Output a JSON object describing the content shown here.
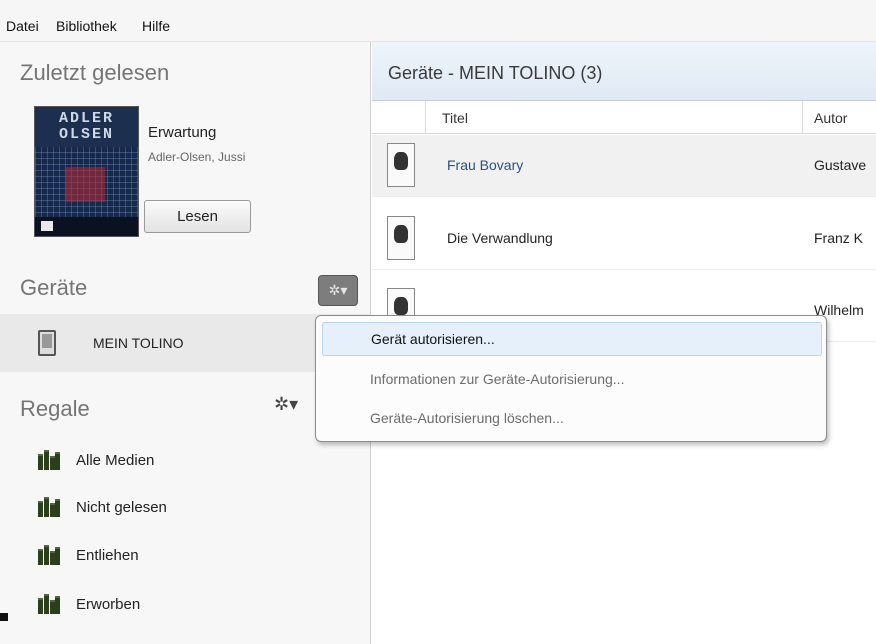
{
  "menubar": {
    "items": [
      "Datei",
      "Bibliothek",
      "Hilfe"
    ]
  },
  "sidebar": {
    "recent": {
      "heading": "Zuletzt gelesen",
      "book": {
        "cover_text": "ADLER OLSEN",
        "title": "Erwartung",
        "author": "Adler-Olsen, Jussi",
        "read_label": "Lesen"
      }
    },
    "devices": {
      "heading": "Geräte",
      "settings_icon": "gear-icon",
      "items": [
        {
          "label": "MEIN TOLINO",
          "icon": "ereader-icon"
        }
      ]
    },
    "shelves": {
      "heading": "Regale",
      "settings_icon": "gear-icon",
      "items": [
        {
          "label": "Alle Medien",
          "icon": "shelf-icon"
        },
        {
          "label": "Nicht gelesen",
          "icon": "shelf-icon"
        },
        {
          "label": "Entliehen",
          "icon": "shelf-icon"
        },
        {
          "label": "Erworben",
          "icon": "shelf-icon"
        }
      ]
    }
  },
  "main": {
    "header_title": "Geräte - MEIN TOLINO (3)",
    "columns": [
      "Titel",
      "Autor"
    ],
    "rows": [
      {
        "title": "Frau Bovary",
        "author": "Gustave",
        "selected": true,
        "title_color": "#2b4f86"
      },
      {
        "title": "Die Verwandlung",
        "author": "Franz K",
        "selected": false,
        "title_color": "#222222"
      },
      {
        "title": "",
        "author": "Wilhelm",
        "selected": false,
        "title_color": "#222222"
      }
    ]
  },
  "context_menu": {
    "items": [
      {
        "label": "Gerät autorisieren...",
        "highlighted": true,
        "enabled": true
      },
      {
        "label": "Informationen zur Geräte-Autorisierung...",
        "highlighted": false,
        "enabled": false
      },
      {
        "label": "Geräte-Autorisierung löschen...",
        "highlighted": false,
        "enabled": false
      }
    ]
  },
  "colors": {
    "header_bg": "#dfe9f4",
    "menu_highlight": "#e5f0fa",
    "link_title": "#2b4f86"
  }
}
